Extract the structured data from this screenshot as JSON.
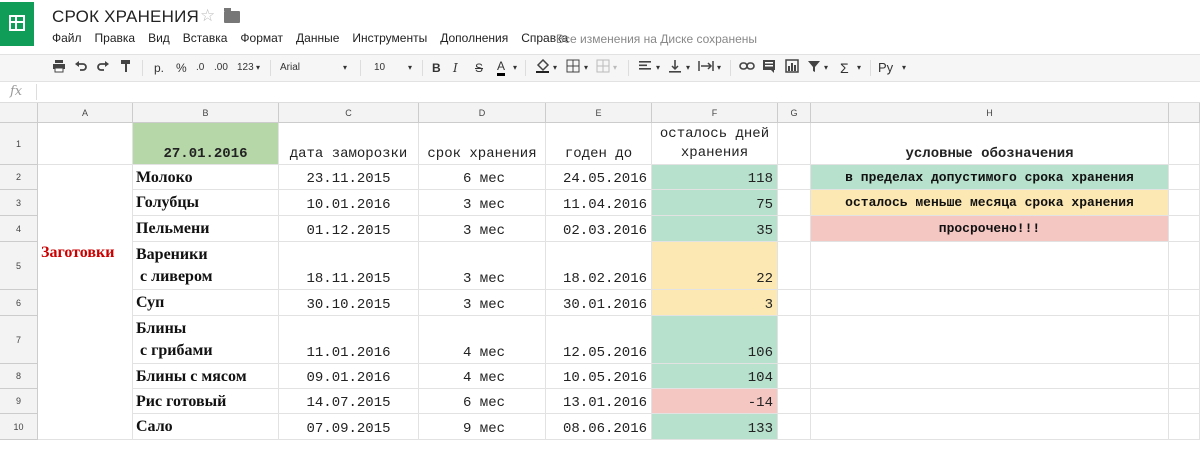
{
  "app": {
    "title": "СРОК ХРАНЕНИЯ",
    "star_icon": "☆",
    "menu": [
      "Файл",
      "Правка",
      "Вид",
      "Вставка",
      "Формат",
      "Данные",
      "Инструменты",
      "Дополнения",
      "Справка"
    ],
    "saved_status": "Все изменения на Диске сохранены"
  },
  "toolbar": {
    "currency": "р.",
    "percent": "%",
    "dec_less": ".0",
    "dec_more": ".00",
    "format_more": "123",
    "font": "Arial",
    "size": "10",
    "bold": "B",
    "italic": "I",
    "strike": "S",
    "text_color": "A",
    "sigma": "Σ",
    "input_tool": "Ру"
  },
  "formula": {
    "fx": "fx",
    "value": ""
  },
  "grid": {
    "columns": [
      "A",
      "B",
      "C",
      "D",
      "E",
      "F",
      "G",
      "H"
    ],
    "rows": [
      "1",
      "2",
      "3",
      "4",
      "5",
      "6",
      "7",
      "8",
      "9",
      "10"
    ],
    "date_header": "27.01.2016",
    "headers": {
      "freeze_date": "дата заморозки",
      "shelf_life": "срок хранения",
      "valid_until": "годен до",
      "days_left_line1": "осталось дней",
      "days_left_line2": "хранения"
    },
    "group_label": "Заготовки",
    "products": [
      {
        "name": "Молоко",
        "freeze": "23.11.2015",
        "shelf": "6 мес",
        "until": "24.05.2016",
        "left": "118",
        "status": "green"
      },
      {
        "name": "Голубцы",
        "freeze": "10.01.2016",
        "shelf": "3 мес",
        "until": "11.04.2016",
        "left": "75",
        "status": "green"
      },
      {
        "name": "Пельмени",
        "freeze": "01.12.2015",
        "shelf": "3 мес",
        "until": "02.03.2016",
        "left": "35",
        "status": "green"
      },
      {
        "name_line1": "Вареники",
        "name_line2": " с ливером",
        "freeze": "18.11.2015",
        "shelf": "3 мес",
        "until": "18.02.2016",
        "left": "22",
        "status": "yellow"
      },
      {
        "name": "Суп",
        "freeze": "30.10.2015",
        "shelf": "3 мес",
        "until": "30.01.2016",
        "left": "3",
        "status": "yellow"
      },
      {
        "name_line1": "Блины",
        "name_line2": " с грибами",
        "freeze": "11.01.2016",
        "shelf": "4 мес",
        "until": "12.05.2016",
        "left": "106",
        "status": "green"
      },
      {
        "name": "Блины с мясом",
        "freeze": "09.01.2016",
        "shelf": "4 мес",
        "until": "10.05.2016",
        "left": "104",
        "status": "green"
      },
      {
        "name": "Рис готовый",
        "freeze": "14.07.2015",
        "shelf": "6 мес",
        "until": "13.01.2016",
        "left": "-14",
        "status": "red"
      },
      {
        "name": "Сало",
        "freeze": "07.09.2015",
        "shelf": "9 мес",
        "until": "08.06.2016",
        "left": "133",
        "status": "green"
      }
    ],
    "legend": {
      "title": "условные обозначения",
      "ok": "в пределах допустимого срока хранения",
      "soon": "осталось меньше месяца срока хранения",
      "expired": "просрочено!!!"
    }
  },
  "colors": {
    "ok": "#b7e1cd",
    "soon": "#fce8b2",
    "expired": "#f4c7c3",
    "header": "#b6d7a8",
    "group_label": "#cc0000"
  }
}
